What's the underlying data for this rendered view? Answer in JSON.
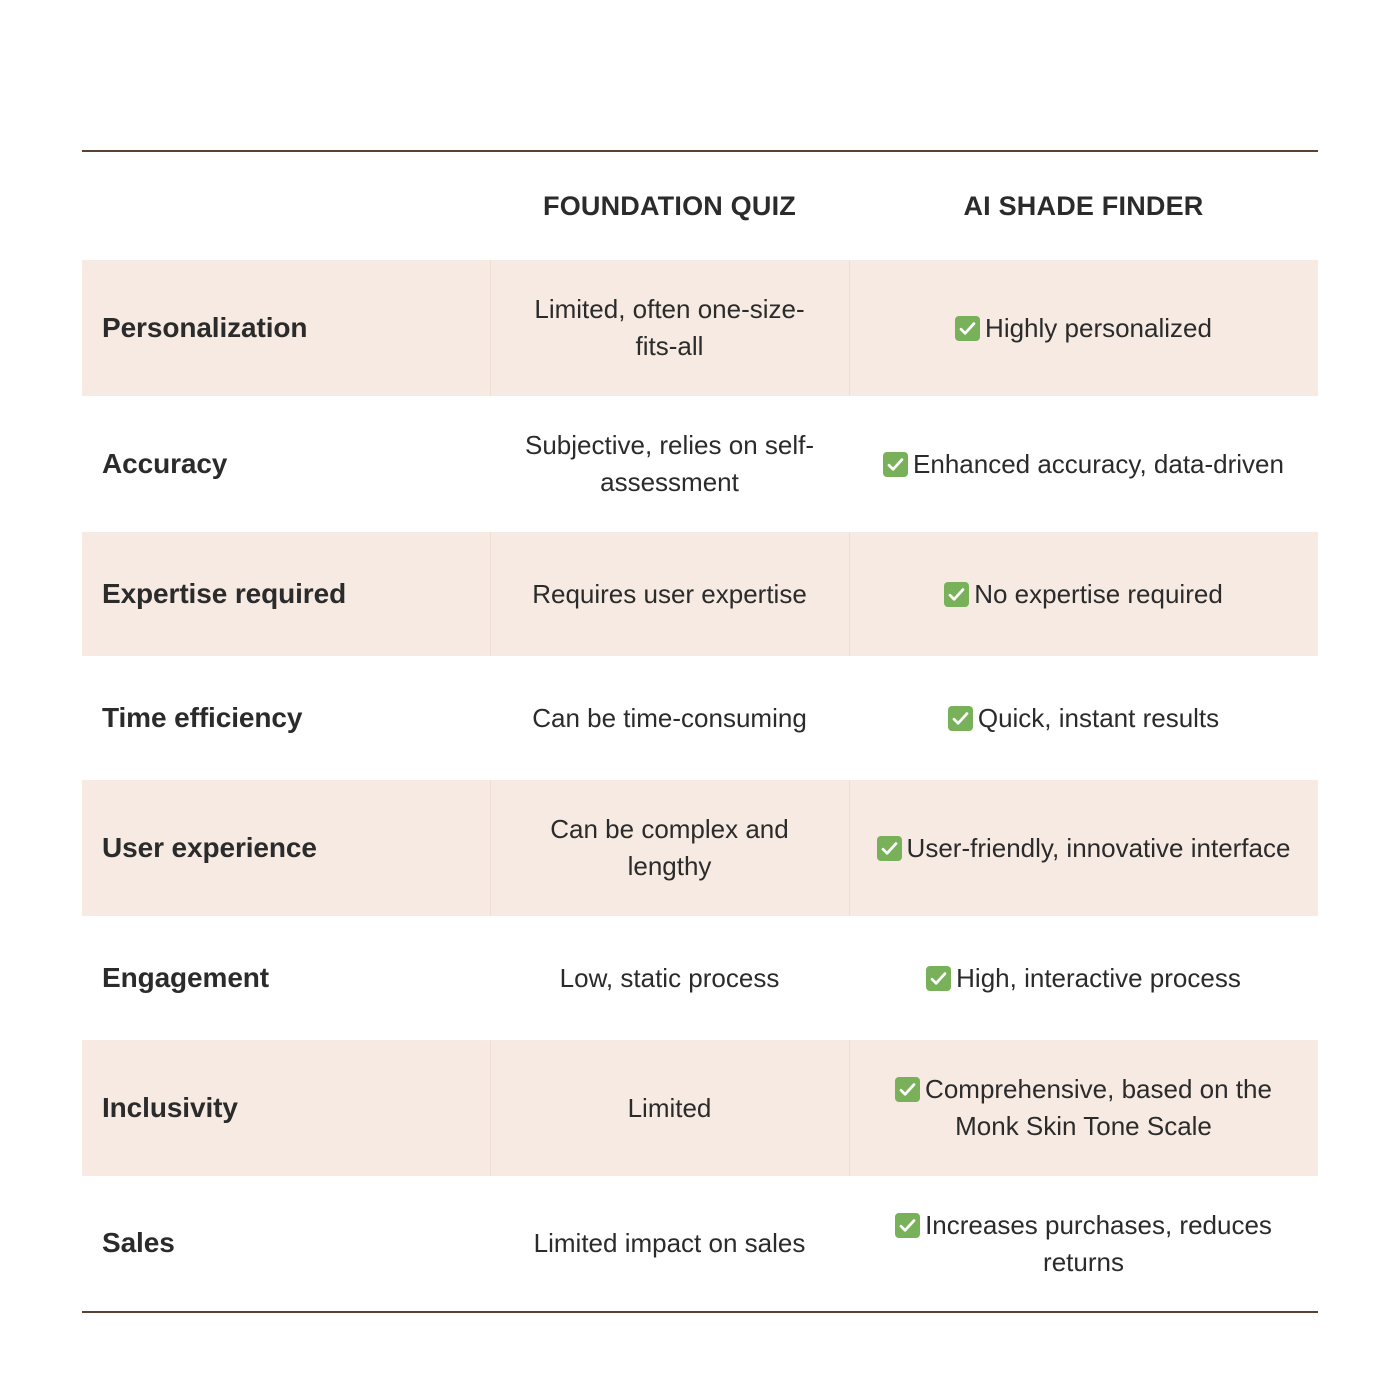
{
  "table": {
    "columns": {
      "feature_header": "",
      "quiz_header": "FOUNDATION QUIZ",
      "ai_header": "AI SHADE FINDER"
    },
    "colors": {
      "row_shade": "#F6EAE3",
      "row_plain": "#FFFFFF",
      "border": "#5C4233",
      "text": "#2B2B2B",
      "check_green": "#78B159",
      "check_glyph": "#FFFFFF",
      "divider": "#EFDDD4"
    },
    "check_icon_name": "check-mark-button-icon",
    "rows": [
      {
        "feature": "Personalization",
        "quiz": "Limited, often one-size-fits-all",
        "ai": "Highly personalized",
        "ai_check": true,
        "shaded": true,
        "tall": true
      },
      {
        "feature": "Accuracy",
        "quiz": "Subjective, relies on self-assessment",
        "ai": "Enhanced accuracy, data-driven",
        "ai_check": true,
        "shaded": false,
        "tall": true
      },
      {
        "feature": "Expertise required",
        "quiz": "Requires user expertise",
        "ai": "No expertise required",
        "ai_check": true,
        "shaded": true,
        "tall": false
      },
      {
        "feature": "Time efficiency",
        "quiz": "Can be time-consuming",
        "ai": "Quick, instant results",
        "ai_check": true,
        "shaded": false,
        "tall": false
      },
      {
        "feature": "User experience",
        "quiz": "Can be complex and lengthy",
        "ai": "User-friendly, innovative interface",
        "ai_check": true,
        "shaded": true,
        "tall": true
      },
      {
        "feature": "Engagement",
        "quiz": "Low, static process",
        "ai": "High, interactive process",
        "ai_check": true,
        "shaded": false,
        "tall": false
      },
      {
        "feature": "Inclusivity",
        "quiz": "Limited",
        "ai": "Comprehensive, based on the Monk Skin Tone Scale",
        "ai_check": true,
        "shaded": true,
        "tall": true
      },
      {
        "feature": "Sales",
        "quiz": "Limited impact on sales",
        "ai": "Increases purchases, reduces returns",
        "ai_check": true,
        "shaded": false,
        "tall": true
      }
    ]
  }
}
